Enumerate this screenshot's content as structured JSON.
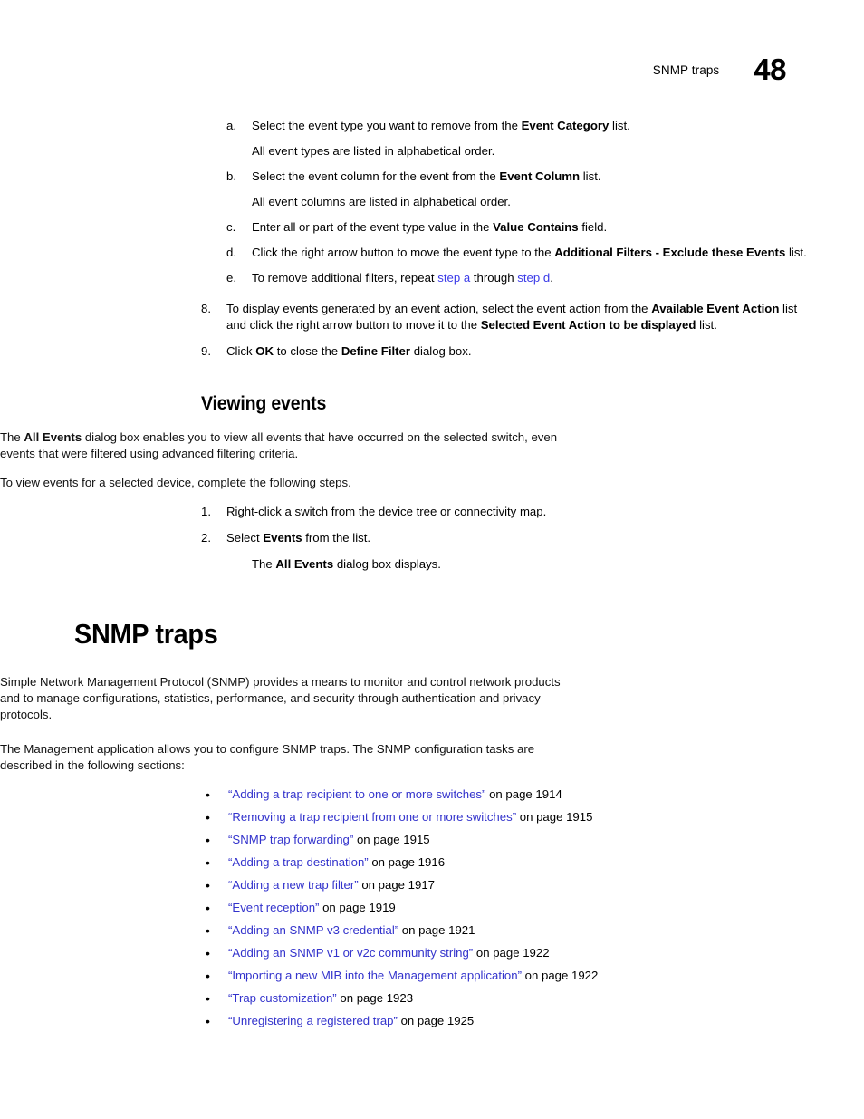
{
  "header": {
    "title": "SNMP traps",
    "chapter": "48"
  },
  "alpha_steps": [
    {
      "marker": "a.",
      "pre": "Select the event type you want to remove from the ",
      "bold": "Event Category",
      "post": " list.",
      "note": "All event types are listed in alphabetical order."
    },
    {
      "marker": "b.",
      "pre": "Select the event column for the event from the ",
      "bold": "Event Column",
      "post": " list.",
      "note": "All event columns are listed in alphabetical order."
    },
    {
      "marker": "c.",
      "pre": "Enter all or part of the event type value in the ",
      "bold": "Value Contains",
      "post": " field.",
      "note": ""
    },
    {
      "marker": "d.",
      "pre": "Click the right arrow button to move the event type to the ",
      "bold": "Additional Filters - Exclude these Events",
      "post": " list.",
      "note": ""
    },
    {
      "marker": "e.",
      "pre": "To remove additional filters, repeat ",
      "link_a": "step a",
      "mid": " through ",
      "link_b": "step d",
      "post": ".",
      "note": ""
    }
  ],
  "numbered_steps_top": [
    {
      "marker": "8.",
      "p1": "To display events generated by an event action, select the event action from the ",
      "b1": "Available Event Action",
      "p2": " list and click the right arrow button to move it to the ",
      "b2": "Selected Event Action to be displayed",
      "p3": " list."
    },
    {
      "marker": "9.",
      "p1": "Click ",
      "b1": "OK",
      "p2": " to close the ",
      "b2": "Define Filter",
      "p3": " dialog box."
    }
  ],
  "viewing_events": {
    "heading": "Viewing events",
    "intro_pre": "The ",
    "intro_bold": "All Events",
    "intro_post": " dialog box enables you to view all events that have occurred on the selected switch, even events that were filtered using advanced filtering criteria.",
    "lead_in": "To view events for a selected device, complete the following steps.",
    "steps": [
      {
        "marker": "1.",
        "p1": "Right-click a switch from the device tree or connectivity map.",
        "b1": "",
        "p2": ""
      },
      {
        "marker": "2.",
        "p1": "Select ",
        "b1": "Events",
        "p2": " from the list."
      }
    ],
    "result_pre": "The ",
    "result_bold": "All Events",
    "result_post": " dialog box displays."
  },
  "snmp_traps": {
    "heading": "SNMP traps",
    "para1": "Simple Network Management Protocol (SNMP) provides a means to monitor and control network products and to manage configurations, statistics, performance, and security through authentication and privacy protocols.",
    "para2": "The Management application allows you to configure SNMP traps. The SNMP configuration tasks are described in the following sections:",
    "links": [
      {
        "bullet": "•",
        "title": "“Adding a trap recipient to one or more switches”",
        "page": " on page 1914"
      },
      {
        "bullet": "•",
        "title": "“Removing a trap recipient from one or more switches”",
        "page": " on page 1915"
      },
      {
        "bullet": "•",
        "title": "“SNMP trap forwarding”",
        "page": " on page 1915"
      },
      {
        "bullet": "•",
        "title": "“Adding a trap destination”",
        "page": " on page 1916"
      },
      {
        "bullet": "•",
        "title": "“Adding a new trap filter”",
        "page": " on page 1917"
      },
      {
        "bullet": "•",
        "title": "“Event reception”",
        "page": " on page 1919"
      },
      {
        "bullet": "•",
        "title": "“Adding an SNMP v3 credential”",
        "page": " on page 1921"
      },
      {
        "bullet": "•",
        "title": "“Adding an SNMP v1 or v2c community string”",
        "page": " on page 1922"
      },
      {
        "bullet": "•",
        "title": "“Importing a new MIB into the Management application”",
        "page": " on page 1922"
      },
      {
        "bullet": "•",
        "title": "“Trap customization”",
        "page": " on page 1923"
      },
      {
        "bullet": "•",
        "title": "“Unregistering a registered trap”",
        "page": " on page 1925"
      }
    ]
  },
  "colors": {
    "xref_blue": "#3333cc",
    "step_blue": "#3a3ae8",
    "text_black": "#000000"
  }
}
